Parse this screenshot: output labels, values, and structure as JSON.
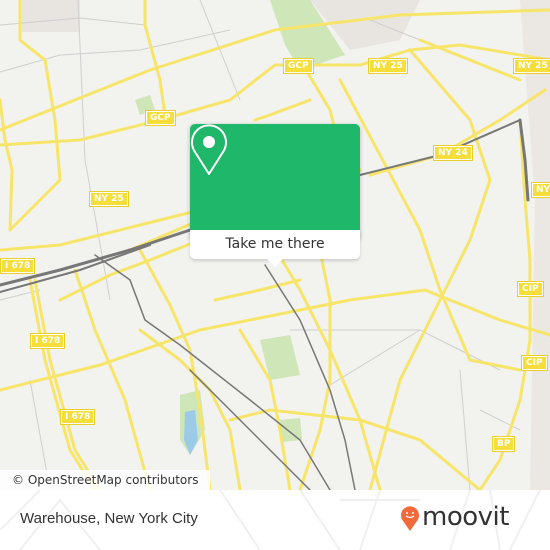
{
  "map": {
    "road_labels": [
      {
        "text": "GCP"
      },
      {
        "text": "GCP"
      },
      {
        "text": "NY 25"
      },
      {
        "text": "NY 25"
      },
      {
        "text": "NY 25"
      },
      {
        "text": "NY 24"
      },
      {
        "text": "NY"
      },
      {
        "text": "I 678"
      },
      {
        "text": "I 678"
      },
      {
        "text": "I 678"
      },
      {
        "text": "CIP"
      },
      {
        "text": "CIP"
      },
      {
        "text": "BP"
      }
    ],
    "colors": {
      "background": "#f2f2ef",
      "road": "#f7e56a",
      "rail": "#777777",
      "park": "#cfe6b8",
      "water": "#9ccbe8",
      "accent": "#1fb86a"
    }
  },
  "popup": {
    "icon": "map-pin-icon",
    "action_label": "Take me there"
  },
  "attribution": "© OpenStreetMap contributors",
  "footer": {
    "place_name": "Warehouse, New York City",
    "brand": "moovit",
    "brand_color": "#f26a3c"
  }
}
